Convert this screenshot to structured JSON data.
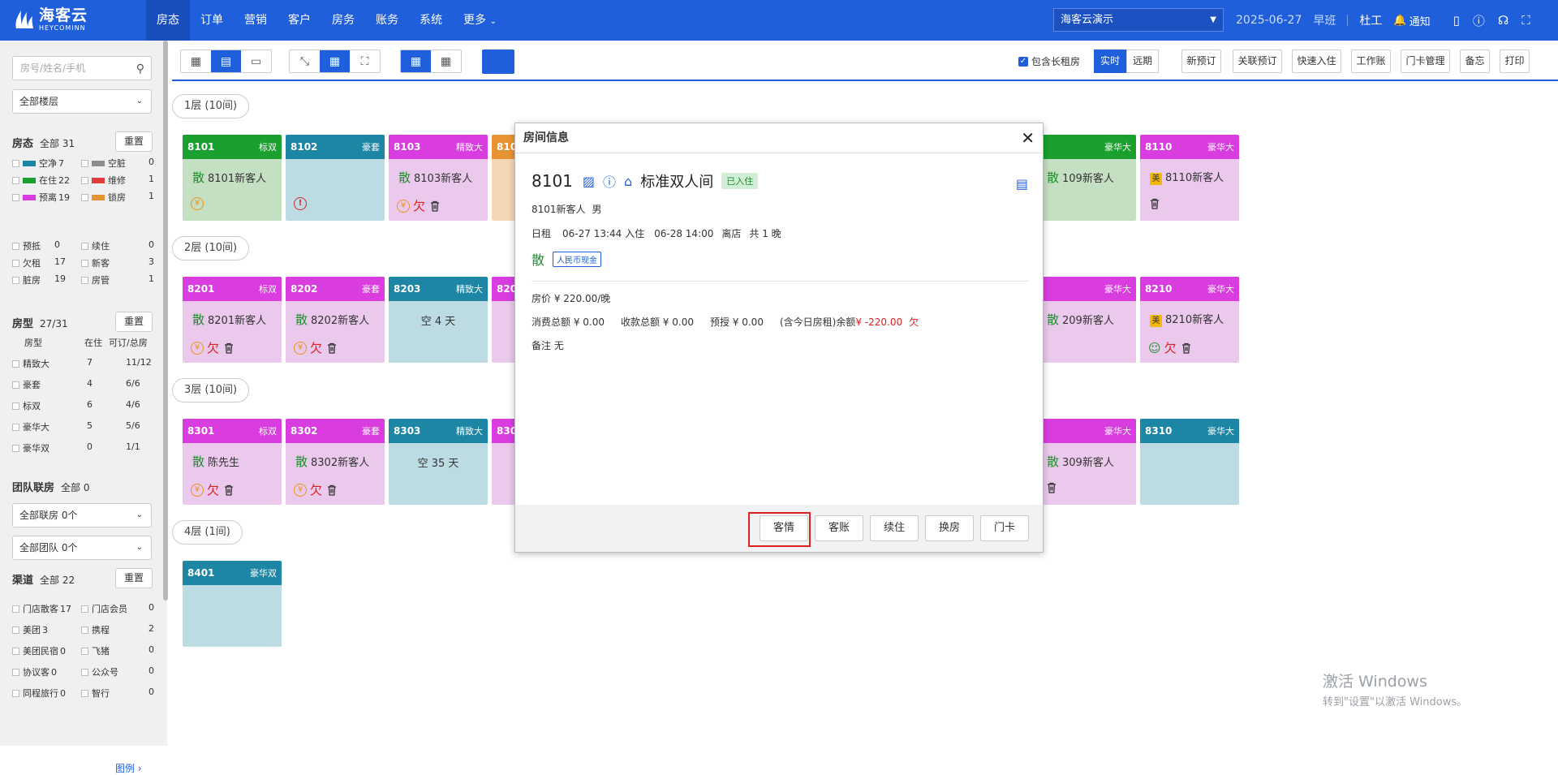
{
  "brand": {
    "name_cn": "海客云",
    "name_en": "HEYCOMINN"
  },
  "nav": {
    "items": [
      "房态",
      "订单",
      "营销",
      "客户",
      "房务",
      "账务",
      "系统",
      "更多"
    ],
    "hotel": "海客云演示",
    "date": "2025-06-27",
    "shift": "早班",
    "user": "杜工",
    "notice": "通知"
  },
  "sidebar": {
    "search_placeholder": "房号/姓名/手机",
    "floor_select": "全部楼层",
    "status": {
      "title": "房态",
      "sub": "全部 31",
      "reset": "重置",
      "items": [
        {
          "label": "空净",
          "n": "7",
          "color": "#1d86a5",
          "label2": "空脏",
          "n2": "0",
          "color2": "#8c8c8c"
        },
        {
          "label": "在住",
          "n": "22",
          "color": "#1aa02e",
          "label2": "维修",
          "n2": "1",
          "color2": "#e03a3a"
        },
        {
          "label": "预离",
          "n": "19",
          "color": "#d93de0",
          "label2": "锁房",
          "n2": "1",
          "color2": "#e89333"
        }
      ],
      "items2": [
        {
          "l1": "预抵",
          "n1": "0",
          "l2": "续住",
          "n2": "0"
        },
        {
          "l1": "欠租",
          "n1": "17",
          "l2": "新客",
          "n2": "3"
        },
        {
          "l1": "脏房",
          "n1": "19",
          "l2": "房管",
          "n2": "1"
        }
      ]
    },
    "roomtype": {
      "title": "房型",
      "sub": "27/31",
      "reset": "重置",
      "headers": [
        "房型",
        "在住",
        "可订/总房"
      ],
      "rows": [
        {
          "name": "精致大",
          "in": "7",
          "avail": "11/12"
        },
        {
          "name": "豪套",
          "in": "4",
          "avail": "6/6"
        },
        {
          "name": "标双",
          "in": "6",
          "avail": "4/6"
        },
        {
          "name": "豪华大",
          "in": "5",
          "avail": "5/6"
        },
        {
          "name": "豪华双",
          "in": "0",
          "avail": "1/1"
        }
      ]
    },
    "team": {
      "title": "团队联房",
      "sub": "全部 0",
      "select1": "全部联房 0个",
      "select2": "全部团队 0个"
    },
    "channel": {
      "title": "渠道",
      "sub": "全部 22",
      "reset": "重置",
      "rows": [
        {
          "l1": "门店散客",
          "n1": "17",
          "l2": "门店会员",
          "n2": "0"
        },
        {
          "l1": "美团",
          "n1": "3",
          "l2": "携程",
          "n2": "2"
        },
        {
          "l1": "美团民宿",
          "n1": "0",
          "l2": "飞猪",
          "n2": "0"
        },
        {
          "l1": "协议客",
          "n1": "0",
          "l2": "公众号",
          "n2": "0"
        },
        {
          "l1": "同程旅行",
          "n1": "0",
          "l2": "智行",
          "n2": "0"
        }
      ]
    },
    "legend_link": "图例"
  },
  "toolbar": {
    "long_rent": "包含长租房",
    "realtime": "实时",
    "future": "远期",
    "actions": [
      "新预订",
      "关联预订",
      "快速入住",
      "工作账",
      "门卡管理",
      "备忘",
      "打印"
    ]
  },
  "floors": [
    {
      "label": "1层 (10间)",
      "rooms": [
        {
          "no": "8101",
          "type": "标双",
          "color": "green",
          "guest": "8101新客人",
          "icons": [
            "yen"
          ]
        },
        {
          "no": "8102",
          "type": "豪套",
          "color": "teal",
          "guest": "",
          "icons": [
            "excl"
          ]
        },
        {
          "no": "8103",
          "type": "精致大",
          "color": "purple",
          "guest": "8103新客人",
          "icons": [
            "yen",
            "owe",
            "trash"
          ]
        },
        {
          "no": "810",
          "type": "",
          "color": "orange",
          "guest": "",
          "icons": []
        },
        {
          "no": "",
          "type": "豪华大",
          "color": "green",
          "guest": "109新客人",
          "icons": []
        },
        {
          "no": "8110",
          "type": "豪华大",
          "color": "purple",
          "guest": "8110新客人",
          "mei": true,
          "icons": [
            "trash"
          ]
        }
      ]
    },
    {
      "label": "2层 (10间)",
      "rooms": [
        {
          "no": "8201",
          "type": "标双",
          "color": "purple",
          "guest": "8201新客人",
          "icons": [
            "yen",
            "owe",
            "trash"
          ]
        },
        {
          "no": "8202",
          "type": "豪套",
          "color": "purple",
          "guest": "8202新客人",
          "icons": [
            "yen",
            "owe",
            "trash"
          ]
        },
        {
          "no": "8203",
          "type": "精致大",
          "color": "teal",
          "empty": "空 4 天",
          "icons": []
        },
        {
          "no": "820",
          "type": "",
          "color": "purple",
          "guest": "",
          "icons": []
        },
        {
          "no": "",
          "type": "豪华大",
          "color": "purple",
          "guest": "209新客人",
          "icons": []
        },
        {
          "no": "8210",
          "type": "豪华大",
          "color": "purple",
          "guest": "8210新客人",
          "mei": true,
          "icons": [
            "chat",
            "owe",
            "trash"
          ]
        }
      ]
    },
    {
      "label": "3层 (10间)",
      "rooms": [
        {
          "no": "8301",
          "type": "标双",
          "color": "purple",
          "guest": "陈先生",
          "icons": [
            "yen",
            "owe",
            "trash"
          ]
        },
        {
          "no": "8302",
          "type": "豪套",
          "color": "purple",
          "guest": "8302新客人",
          "icons": [
            "yen",
            "owe",
            "trash"
          ]
        },
        {
          "no": "8303",
          "type": "精致大",
          "color": "teal",
          "empty": "空 35 天",
          "icons": []
        },
        {
          "no": "830",
          "type": "",
          "color": "purple",
          "guest": "",
          "icons": []
        },
        {
          "no": "",
          "type": "豪华大",
          "color": "purple",
          "guest": "309新客人",
          "icons": [
            "trash"
          ]
        },
        {
          "no": "8310",
          "type": "豪华大",
          "color": "teal",
          "guest": "",
          "icons": []
        }
      ]
    },
    {
      "label": "4层 (1间)",
      "rooms": [
        {
          "no": "8401",
          "type": "豪华双",
          "color": "teal",
          "guest": "",
          "icons": []
        }
      ]
    }
  ],
  "modal": {
    "title": "房间信息",
    "room_no": "8101",
    "room_type": "标准双人间",
    "status_tag": "已入住",
    "guest": "8101新客人",
    "gender": "男",
    "rent_type": "日租",
    "checkin": "06-27 13:44 入住",
    "checkout": "06-28 14:00",
    "channel": "离店",
    "nights": "共 1 晚",
    "san": "散",
    "payment_tag": "人民币现金",
    "price": "房价 ¥ 220.00/晚",
    "consume": "消费总额 ¥ 0.00",
    "received": "收款总额 ¥ 0.00",
    "preauth": "预授 ¥ 0.00",
    "balance_label": "(含今日房租)余额",
    "balance": "¥ -220.00",
    "owe": "欠",
    "remark": "备注 无",
    "buttons": [
      "客情",
      "客账",
      "续住",
      "换房",
      "门卡"
    ]
  },
  "watermark": {
    "line1": "激活 Windows",
    "line2": "转到\"设置\"以激活 Windows。"
  }
}
